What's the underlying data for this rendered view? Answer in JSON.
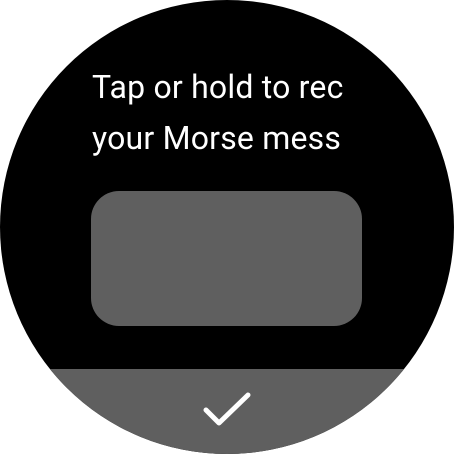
{
  "prompt": {
    "line1": "Tap or hold to rec",
    "line2": "your Morse mess"
  },
  "tap_pad": {
    "label": ""
  },
  "confirm_button": {
    "icon": "check-icon"
  },
  "colors": {
    "background": "#000000",
    "text": "#ffffff",
    "surface": "#5f5f5f"
  }
}
